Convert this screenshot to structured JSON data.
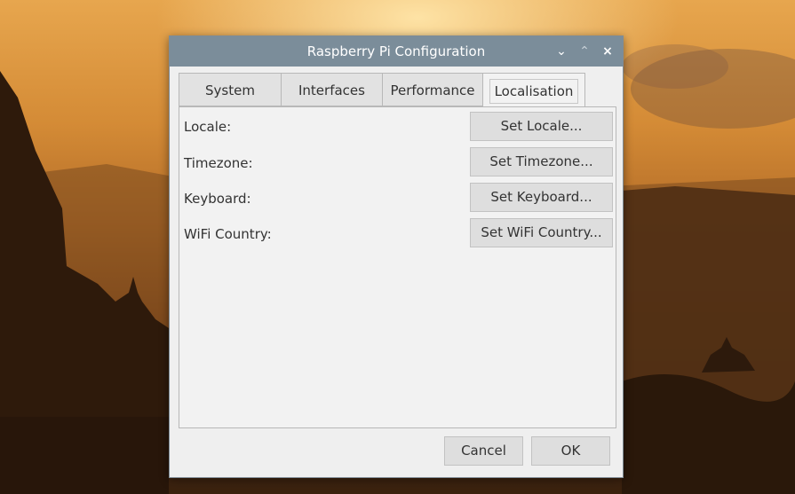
{
  "window": {
    "title": "Raspberry Pi Configuration",
    "controls": {
      "minimize": "⌄",
      "maximize": "⌃",
      "close": "×"
    }
  },
  "tabs": [
    {
      "label": "System"
    },
    {
      "label": "Interfaces"
    },
    {
      "label": "Performance"
    },
    {
      "label": "Localisation"
    }
  ],
  "active_tab": "Localisation",
  "localisation": {
    "rows": [
      {
        "label": "Locale:",
        "button": "Set Locale..."
      },
      {
        "label": "Timezone:",
        "button": "Set Timezone..."
      },
      {
        "label": "Keyboard:",
        "button": "Set Keyboard..."
      },
      {
        "label": "WiFi Country:",
        "button": "Set WiFi Country..."
      }
    ]
  },
  "footer": {
    "cancel": "Cancel",
    "ok": "OK"
  },
  "colors": {
    "titlebar": "#7b8d9a",
    "dialog_bg": "#efefef",
    "button_bg": "#dedede"
  }
}
